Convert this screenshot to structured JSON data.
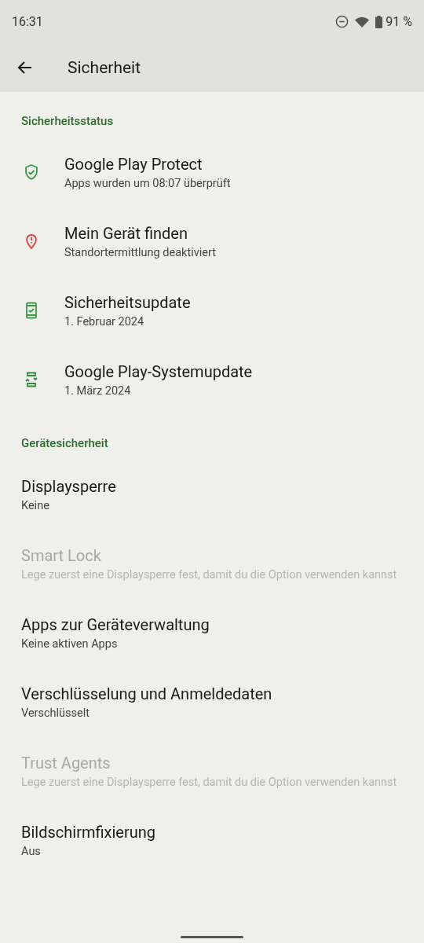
{
  "status_bar": {
    "time": "16:31",
    "battery": "91 %"
  },
  "app_bar": {
    "title": "Sicherheit"
  },
  "sections": [
    {
      "header": "Sicherheitsstatus",
      "items": [
        {
          "title": "Google Play Protect",
          "subtitle": "Apps wurden um 08:07 überprüft",
          "kind": "shield",
          "color": "#3a9a48",
          "disabled": false
        },
        {
          "title": "Mein Gerät finden",
          "subtitle": "Standortermittlung deaktiviert",
          "kind": "pin",
          "color": "#e53935",
          "disabled": false
        },
        {
          "title": "Sicherheitsupdate",
          "subtitle": "1. Februar 2024",
          "kind": "phone-check",
          "color": "#3a9a48",
          "disabled": false
        },
        {
          "title": "Google Play-Systemupdate",
          "subtitle": "1. März 2024",
          "kind": "phone-sync",
          "color": "#2e8b3a",
          "disabled": false
        }
      ]
    },
    {
      "header": "Gerätesicherheit",
      "items": [
        {
          "title": "Displaysperre",
          "subtitle": "Keine",
          "disabled": false
        },
        {
          "title": "Smart Lock",
          "subtitle": "Lege zuerst eine Displaysperre fest, damit du die Option verwenden kannst",
          "disabled": true
        },
        {
          "title": "Apps zur Geräteverwaltung",
          "subtitle": "Keine aktiven Apps",
          "disabled": false
        },
        {
          "title": "Verschlüsselung und Anmeldedaten",
          "subtitle": "Verschlüsselt",
          "disabled": false
        },
        {
          "title": "Trust Agents",
          "subtitle": "Lege zuerst eine Displaysperre fest, damit du die Option verwenden kannst",
          "disabled": true
        },
        {
          "title": "Bildschirmfixierung",
          "subtitle": "Aus",
          "disabled": false
        }
      ]
    }
  ]
}
